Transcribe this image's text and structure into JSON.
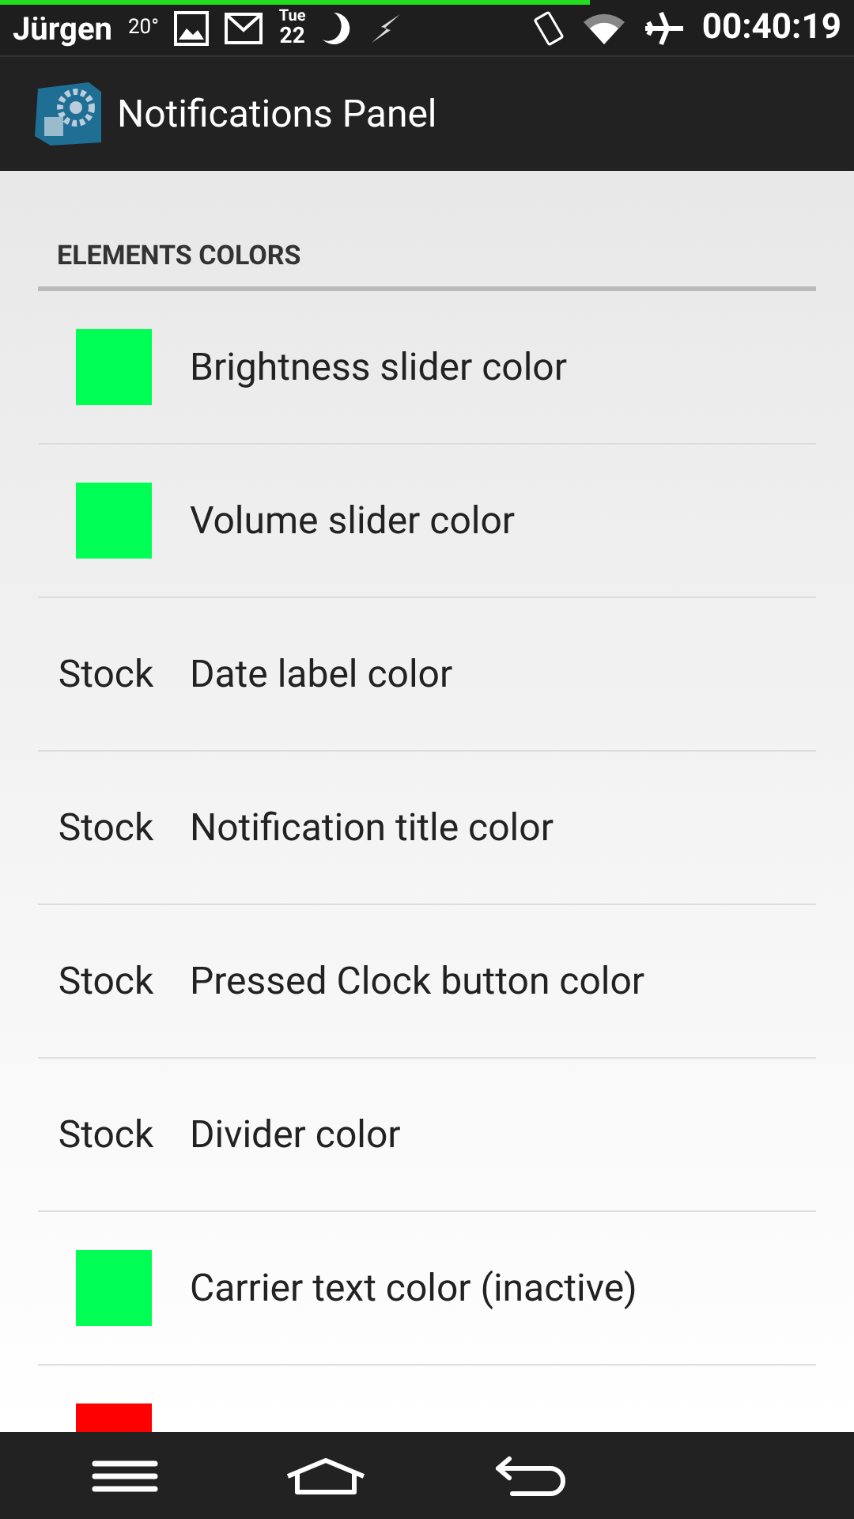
{
  "status_bar": {
    "battery_bar": {
      "level": 0.69
    },
    "user": "Jürgen",
    "temperature": "20°",
    "day": "Tue",
    "date": "22",
    "time": "00:40:19"
  },
  "app_bar": {
    "title": "Notifications Panel"
  },
  "section": {
    "title": "ELEMENTS COLORS"
  },
  "items": [
    {
      "kind": "swatch",
      "color": "#00ff55",
      "label": "Brightness slider color"
    },
    {
      "kind": "swatch",
      "color": "#00ff55",
      "label": "Volume slider color"
    },
    {
      "kind": "text",
      "value": "Stock",
      "label": "Date label color"
    },
    {
      "kind": "text",
      "value": "Stock",
      "label": "Notification title color"
    },
    {
      "kind": "text",
      "value": "Stock",
      "label": "Pressed Clock button color"
    },
    {
      "kind": "text",
      "value": "Stock",
      "label": "Divider color"
    },
    {
      "kind": "swatch",
      "color": "#00ff55",
      "label": "Carrier text color (inactive)"
    },
    {
      "kind": "swatch",
      "color": "#ff0000"
    }
  ]
}
